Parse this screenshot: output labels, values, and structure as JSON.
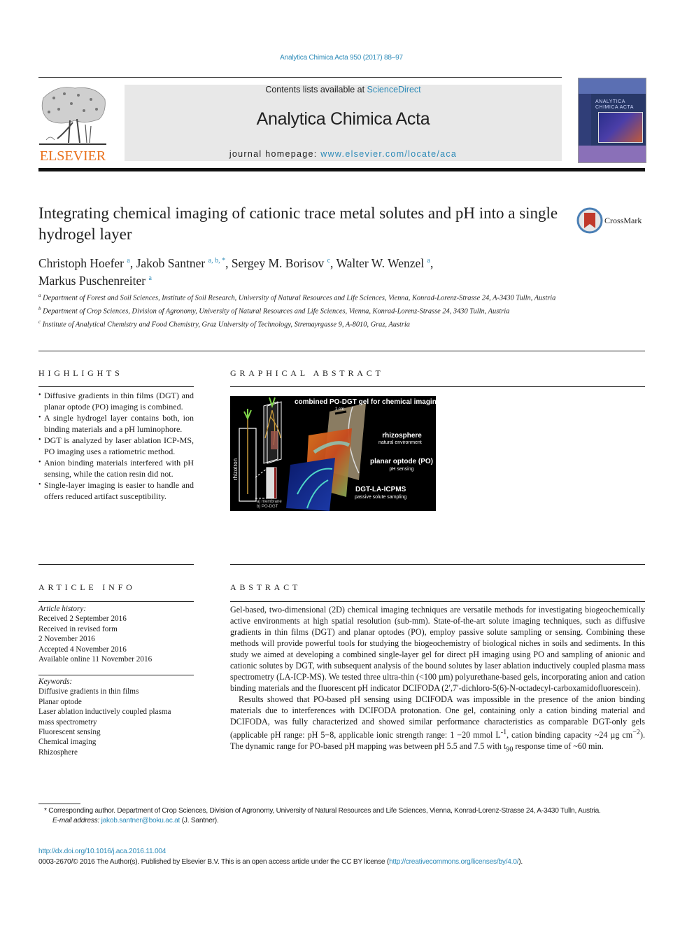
{
  "header": {
    "journal_ref": "Analytica Chimica Acta 950 (2017) 88–97",
    "contents_prefix": "Contents lists available at ",
    "contents_link": "ScienceDirect",
    "journal_title": "Analytica Chimica Acta",
    "homepage_prefix": "journal homepage: ",
    "homepage_link": "www.elsevier.com/locate/aca",
    "publisher_logo_text": "ELSEVIER",
    "cover_title": "ANALYTICA CHIMICA ACTA",
    "brand_color": "#e9711c",
    "link_color": "#2e8bb8"
  },
  "article": {
    "title": "Integrating chemical imaging of cationic trace metal solutes and pH into a single hydrogel layer",
    "crossmark_label": "CrossMark",
    "authors": [
      {
        "name": "Christoph Hoefer",
        "sup": "a"
      },
      {
        "name": "Jakob Santner",
        "sup": "a, b, *"
      },
      {
        "name": "Sergey M. Borisov",
        "sup": "c"
      },
      {
        "name": "Walter W. Wenzel",
        "sup": "a"
      },
      {
        "name": "Markus Puschenreiter",
        "sup": "a"
      }
    ],
    "affiliations": [
      {
        "key": "a",
        "text": "Department of Forest and Soil Sciences, Institute of Soil Research, University of Natural Resources and Life Sciences, Vienna, Konrad-Lorenz-Strasse 24, A-3430 Tulln, Austria"
      },
      {
        "key": "b",
        "text": "Department of Crop Sciences, Division of Agronomy, University of Natural Resources and Life Sciences, Vienna, Konrad-Lorenz-Strasse 24, 3430 Tulln, Austria"
      },
      {
        "key": "c",
        "text": "Institute of Analytical Chemistry and Food Chemistry, Graz University of Technology, Stremayrgasse 9, A-8010, Graz, Austria"
      }
    ]
  },
  "highlights": {
    "heading": "HIGHLIGHTS",
    "items": [
      "Diffusive gradients in thin films (DGT) and planar optode (PO) imaging is combined.",
      "A single hydrogel layer contains both, ion binding materials and a pH luminophore.",
      "DGT is analyzed by laser ablation ICP-MS, PO imaging uses a ratiometric method.",
      "Anion binding materials interfered with pH sensing, while the cation resin did not.",
      "Single-layer imaging is easier to handle and offers reduced artifact susceptibility."
    ]
  },
  "graphical_abstract": {
    "heading": "GRAPHICAL ABSTRACT",
    "figure_title": "combined PO-DGT gel for chemical imaging",
    "scale_label": "1 cm",
    "rhizotron_label": "rhizotron",
    "legend_a": "a) membrane",
    "legend_b": "b) PO-DGT",
    "layers": [
      {
        "title": "rhizosphere",
        "subtitle": "natural environment"
      },
      {
        "title": "planar optode (PO)",
        "subtitle": "pH sensing"
      },
      {
        "title": "DGT-LA-ICPMS",
        "subtitle": "passive solute sampling"
      }
    ]
  },
  "article_info": {
    "heading": "ARTICLE INFO",
    "history_label": "Article history:",
    "history": [
      "Received 2 September 2016",
      "Received in revised form",
      "2 November 2016",
      "Accepted 4 November 2016",
      "Available online 11 November 2016"
    ],
    "keywords_label": "Keywords:",
    "keywords": [
      "Diffusive gradients in thin films",
      "Planar optode",
      "Laser ablation inductively coupled plasma",
      "mass spectrometry",
      "Fluorescent sensing",
      "Chemical imaging",
      "Rhizosphere"
    ]
  },
  "abstract": {
    "heading": "ABSTRACT",
    "p1": "Gel-based, two-dimensional (2D) chemical imaging techniques are versatile methods for investigating biogeochemically active environments at high spatial resolution (sub-mm). State-of-the-art solute imaging techniques, such as diffusive gradients in thin films (DGT) and planar optodes (PO), employ passive solute sampling or sensing. Combining these methods will provide powerful tools for studying the biogeochemistry of biological niches in soils and sediments. In this study we aimed at developing a combined single-layer gel for direct pH imaging using PO and sampling of anionic and cationic solutes by DGT, with subsequent analysis of the bound solutes by laser ablation inductively coupled plasma mass spectrometry (LA-ICP-MS). We tested three ultra-thin (<100 µm) polyurethane-based gels, incorporating anion and cation binding materials and the fluorescent pH indicator DCIFODA (2′,7′-dichloro-5(6)-N-octadecyl-carboxamidofluorescein).",
    "p2_a": "Results showed that PO-based pH sensing using DCIFODA was impossible in the presence of the anion binding materials due to interferences with DCIFODA protonation. One gel, containing only a cation binding material and DCIFODA, was fully characterized and showed similar performance characteristics as comparable DGT-only gels (applicable pH range: pH 5−8, applicable ionic strength range: 1 −20 mmol L",
    "p2_sup1": "-1",
    "p2_b": ", cation binding capacity ~24 µg cm",
    "p2_sup2": "−2",
    "p2_c": "). The dynamic range for PO-based pH mapping was between pH 5.5 and 7.5 with t",
    "p2_sub": "90",
    "p2_d": " response time of ~60 min."
  },
  "footnotes": {
    "corresponding": "* Corresponding author. Department of Crop Sciences, Division of Agronomy, University of Natural Resources and Life Sciences, Vienna, Konrad-Lorenz-Strasse 24, A-3430 Tulln, Austria.",
    "email_label": "E-mail address: ",
    "email": "jakob.santner@boku.ac.at",
    "email_suffix": " (J. Santner).",
    "doi": "http://dx.doi.org/10.1016/j.aca.2016.11.004",
    "license_prefix": "0003-2670/© 2016 The Author(s). Published by Elsevier B.V. This is an open access article under the CC BY license (",
    "license_link": "http://creativecommons.org/licenses/by/4.0/",
    "license_suffix": ")."
  }
}
